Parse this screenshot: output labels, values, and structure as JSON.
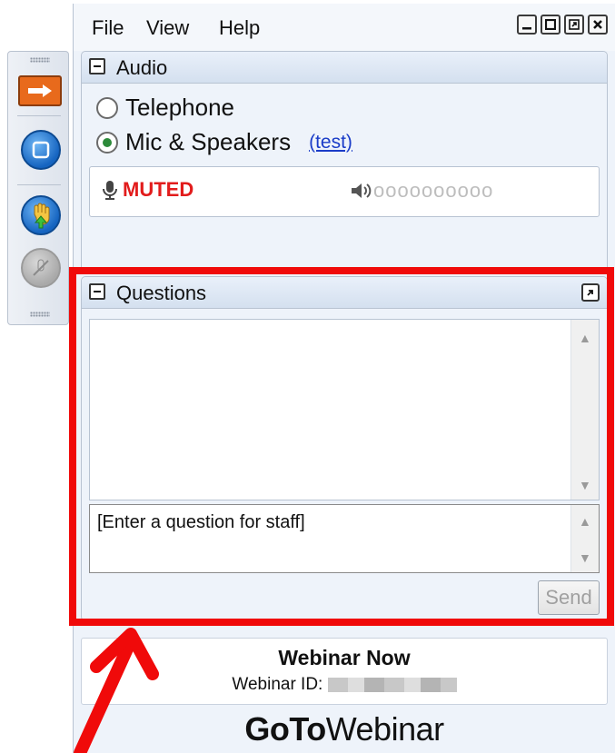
{
  "menu": {
    "file": "File",
    "view": "View",
    "help": "Help"
  },
  "window_controls": {
    "minimize": "_",
    "restore": "❐",
    "popout": "⧉",
    "close": "✕"
  },
  "audio": {
    "title": "Audio",
    "telephone_label": "Telephone",
    "mic_label": "Mic & Speakers",
    "test_link": "(test)",
    "selected": "Mic & Speakers",
    "mic_status": "MUTED",
    "speaker_level": "oooooooooo"
  },
  "questions": {
    "title": "Questions",
    "input_placeholder": "[Enter a question for staff]",
    "send_label": "Send"
  },
  "webinar": {
    "name": "Webinar Now",
    "id_label": "Webinar ID:",
    "brand_bold": "GoTo",
    "brand_regular": "Webinar"
  },
  "colors": {
    "highlight": "#f00a0a",
    "muted": "#e21c1c",
    "link": "#1a3cc8",
    "accent": "#e86a1c"
  }
}
